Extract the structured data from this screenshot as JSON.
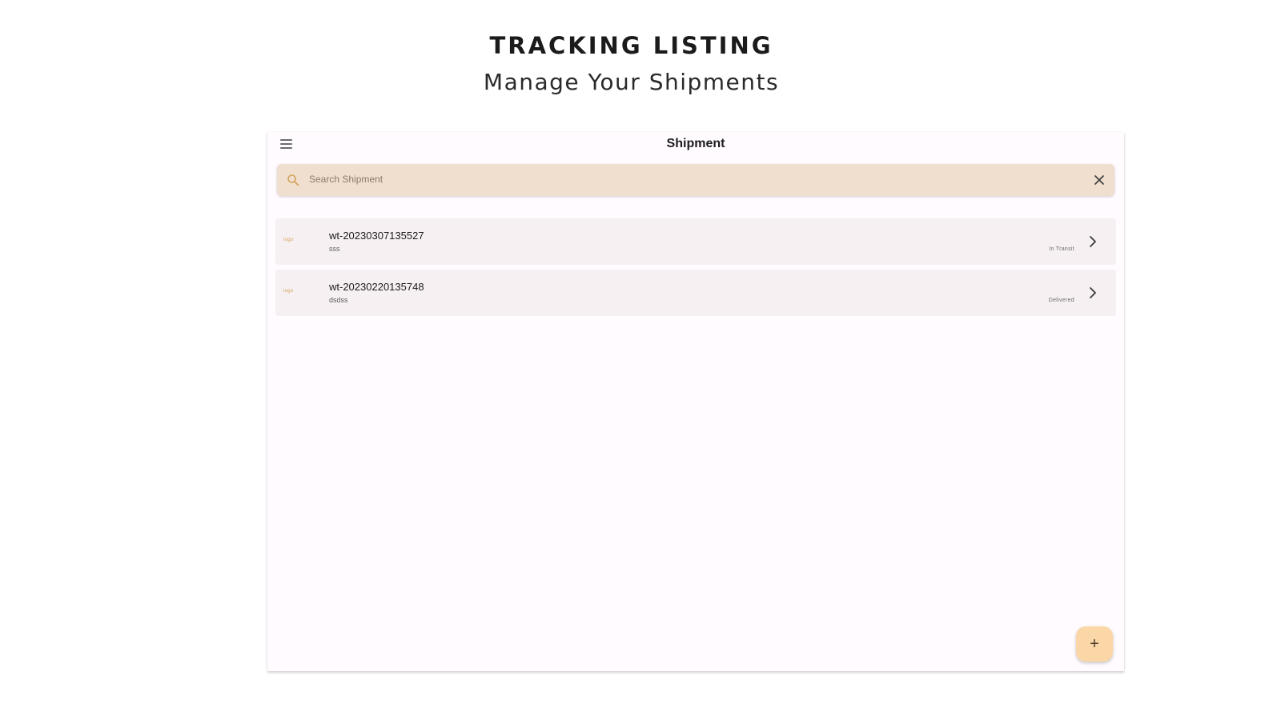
{
  "hero": {
    "title": "TRACKING LISTING",
    "subtitle": "Manage Your Shipments"
  },
  "appbar": {
    "title": "Shipment",
    "menu_icon": "menu-icon"
  },
  "search": {
    "placeholder": "Search Shipment",
    "value": "",
    "search_icon": "search-icon",
    "clear_icon": "close-icon"
  },
  "shipments": [
    {
      "logo": "logo",
      "tracking_id": "wt-20230307135527",
      "description": "sss",
      "status": "In Transit",
      "action_icon": "chevron-right-icon"
    },
    {
      "logo": "logo",
      "tracking_id": "wt-20230220135748",
      "description": "dsdss",
      "status": "Delivered",
      "action_icon": "chevron-right-icon"
    }
  ],
  "fab": {
    "label": "+",
    "icon": "add-icon"
  },
  "colors": {
    "search_background": "#f0dfcf",
    "list_item_background": "#f6f0f2",
    "fab_background": "#fbd7a7",
    "accent": "#d2a45b",
    "surface": "#fffbfe"
  }
}
